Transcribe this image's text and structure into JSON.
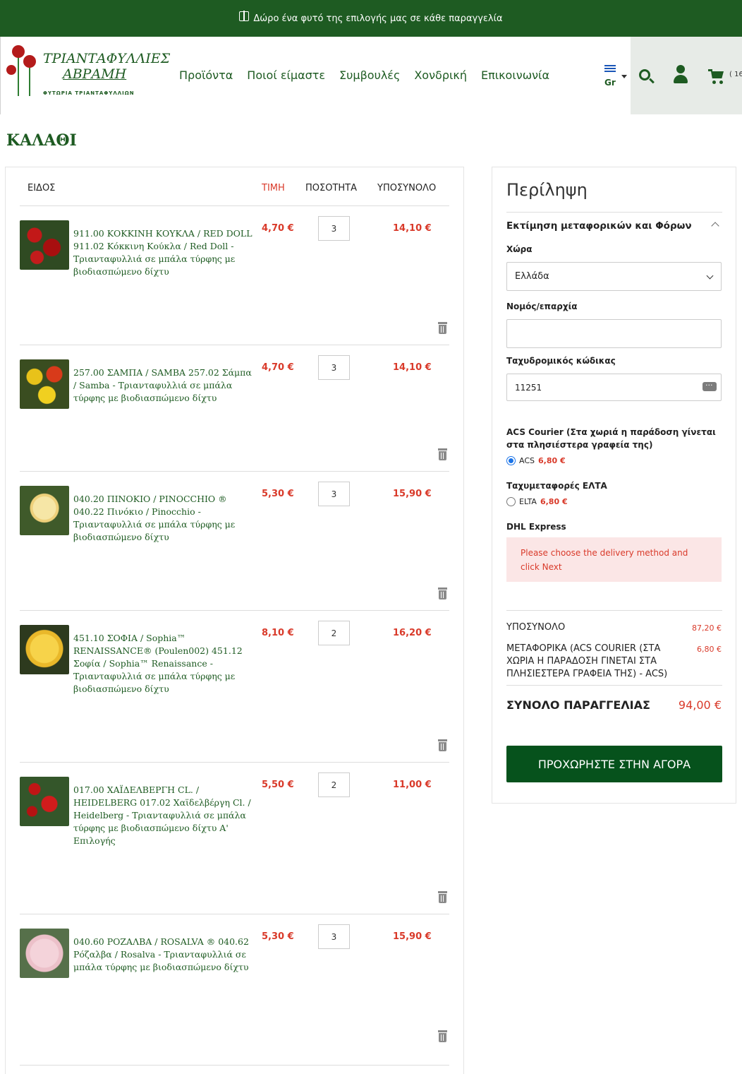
{
  "promo": {
    "text": "Δώρο ένα φυτό της επιλογής μας σε κάθε παραγγελία"
  },
  "logo": {
    "line1": "ΤΡΙΑΝΤΑΦΥΛΛΙΕΣ",
    "line2": "ΑΒΡΑΜΗ",
    "line3": "ΦΥΤΩΡΙΑ ΤΡΙΑΝΤΑΦΥΛΛΙΩΝ"
  },
  "nav": [
    "Προϊόντα",
    "Ποιοί είμαστε",
    "Συμβουλές",
    "Χονδρική",
    "Επικοινωνία"
  ],
  "lang": {
    "code": "Gr"
  },
  "cart_badge": "( 16",
  "page_title": "ΚΑΛΑΘΙ",
  "cart_table": {
    "headers": {
      "item": "ΕΙΔΟΣ",
      "price": "ΤΙΜΗ",
      "qty": "ΠΟΣΟΤΗΤΑ",
      "subtotal": "ΥΠΟΣΥΝΟΛΟ"
    },
    "rows": [
      {
        "name": "911.00 ΚΟΚΚΙΝΗ ΚΟΥΚΛΑ / RED DOLL 911.02 Κόκκινη Κούκλα / Red Doll - Τριανταφυλλιά σε μπάλα τύρφης με βιοδιασπώμενο δίχτυ",
        "price": "4,70 €",
        "qty": "3",
        "subtotal": "14,10 €",
        "image": "red-rose"
      },
      {
        "name": "257.00 ΣΑΜΠΑ / SAMBA 257.02 Σάμπα / Samba - Τριανταφυλλιά σε μπάλα τύρφης με βιοδιασπώμενο δίχτυ",
        "price": "4,70 €",
        "qty": "3",
        "subtotal": "14,10 €",
        "image": "red-yellow-rose"
      },
      {
        "name": "040.20 ΠΙΝΟΚΙΟ / PINOCCHIO ® 040.22 Πινόκιο / Pinocchio - Τριανταφυλλιά σε μπάλα τύρφης με βιοδιασπώμενο δίχτυ",
        "price": "5,30 €",
        "qty": "3",
        "subtotal": "15,90 €",
        "image": "cream-rose"
      },
      {
        "name": "451.10 ΣΟΦΙΑ / Sophia™ RENAISSANCE® (Poulen002) 451.12 Σοφία / Sophia™ Renaissance - Τριανταφυλλιά σε μπάλα τύρφης με βιοδιασπώμενο δίχτυ",
        "price": "8,10 €",
        "qty": "2",
        "subtotal": "16,20 €",
        "image": "yellow-rose"
      },
      {
        "name": "017.00 ΧΑΪΔΕΛΒΕΡΓΗ CL. / HEIDELBERG 017.02 Χαϊδελβέργη Cl. / Heidelberg - Τριανταφυλλιά σε μπάλα τύρφης με βιοδιασπώμενο δίχτυ Α' Επιλογής",
        "price": "5,50 €",
        "qty": "2",
        "subtotal": "11,00 €",
        "image": "red-climbing-rose"
      },
      {
        "name": "040.60 ΡΟΖΑΛΒΑ / ROSALVA ® 040.62 Ρόζαλβα / Rosalva - Τριανταφυλλιά σε μπάλα τύρφης με βιοδιασπώμενο δίχτυ",
        "price": "5,30 €",
        "qty": "3",
        "subtotal": "15,90 €",
        "image": "pink-rose"
      }
    ]
  },
  "summary": {
    "title": "Περίληψη",
    "estimate_title": "Εκτίμηση μεταφορικών και Φόρων",
    "country_label": "Χώρα",
    "country_value": "Ελλάδα",
    "region_label": "Νομός/επαρχία",
    "region_value": "",
    "postcode_label": "Ταχυδρομικός κώδικας",
    "postcode_value": "11251",
    "acs_title": "ACS Courier (Στα χωριά η παράδοση γίνεται στα πλησιέστερα γραφεία της)",
    "acs_option": "ACS",
    "acs_amount": "6,80 €",
    "elta_title": "Ταχυμεταφορές ΕΛΤΑ",
    "elta_option": "ELTA",
    "elta_amount": "6,80 €",
    "dhl_title": "DHL Express",
    "alert": "Please choose the delivery method and click Next",
    "subtotal_label": "ΥΠΟΣΥΝΟΛΟ",
    "subtotal_value": "87,20 €",
    "shipping_label": "ΜΕΤΑΦΟΡΙΚΑ (ACS COURIER (ΣΤΑ ΧΩΡΙΑ Η ΠΑΡΑΔΟΣΗ ΓΙΝΕΤΑΙ ΣΤΑ ΠΛΗΣΙΕΣΤΕΡΑ ΓΡΑΦΕΙΑ ΤΗΣ) - ACS)",
    "shipping_value": "6,80 €",
    "total_label": "ΣΥΝΟΛΟ ΠΑΡΑΓΓΕΛΙΑΣ",
    "total_value": "94,00 €",
    "checkout_label": "ΠΡΟΧΩΡΗΣΤΕ ΣΤΗΝ ΑΓΟΡΑ"
  },
  "colors": {
    "brand_green": "#1e5b22",
    "price_red": "#d93a2a",
    "button_green": "#06521c"
  }
}
